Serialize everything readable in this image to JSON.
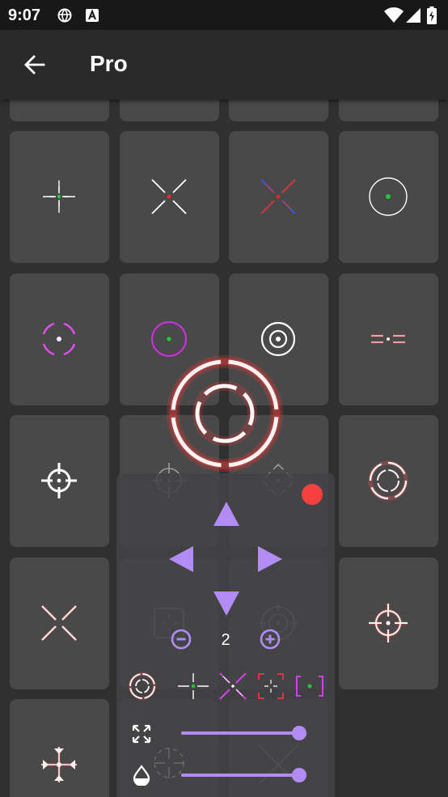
{
  "status_bar": {
    "time": "9:07",
    "icons": [
      "vpn-globe-icon",
      "text-a-icon",
      "wifi-icon",
      "signal-icon",
      "battery-icon"
    ]
  },
  "app_bar": {
    "title": "Pro",
    "back_icon": "arrow-back-icon"
  },
  "crosshair_grid": {
    "columns": 4,
    "tiles": [
      {
        "row": 0,
        "col": 0,
        "icon": "partial-tile"
      },
      {
        "row": 0,
        "col": 1,
        "icon": "partial-tile"
      },
      {
        "row": 0,
        "col": 2,
        "icon": "partial-tile"
      },
      {
        "row": 0,
        "col": 3,
        "icon": "partial-tile"
      },
      {
        "row": 1,
        "col": 0,
        "icon": "plus-green-dot-crosshair-icon"
      },
      {
        "row": 1,
        "col": 1,
        "icon": "x-red-dot-crosshair-icon"
      },
      {
        "row": 1,
        "col": 2,
        "icon": "x-red-blue-crosshair-icon"
      },
      {
        "row": 1,
        "col": 3,
        "icon": "circle-green-dot-crosshair-icon"
      },
      {
        "row": 2,
        "col": 0,
        "icon": "bracket-circle-magenta-icon"
      },
      {
        "row": 2,
        "col": 1,
        "icon": "circle-magenta-green-dot-icon"
      },
      {
        "row": 2,
        "col": 2,
        "icon": "double-circle-icon"
      },
      {
        "row": 2,
        "col": 3,
        "icon": "line-dot-line-red-icon"
      },
      {
        "row": 3,
        "col": 0,
        "icon": "circle-plus-crosshair-icon"
      },
      {
        "row": 3,
        "col": 1,
        "icon": "circle-plus-crosshair-dim-icon"
      },
      {
        "row": 3,
        "col": 2,
        "icon": "diamond-crosshair-icon"
      },
      {
        "row": 3,
        "col": 3,
        "icon": "dashed-double-ring-red-icon"
      },
      {
        "row": 4,
        "col": 0,
        "icon": "x-red-glow-icon"
      },
      {
        "row": 4,
        "col": 1,
        "icon": "square-dotted-icon"
      },
      {
        "row": 4,
        "col": 2,
        "icon": "target-rings-icon"
      },
      {
        "row": 4,
        "col": 3,
        "icon": "circle-cross-red-icon"
      },
      {
        "row": 5,
        "col": 0,
        "icon": "arrow-cross-icon"
      },
      {
        "row": 5,
        "col": 1,
        "icon": "empty"
      },
      {
        "row": 5,
        "col": 2,
        "icon": "x-thin-icon"
      }
    ]
  },
  "preview": {
    "icon": "segmented-double-ring-red-glow-icon",
    "glow_color": "#e23b3b"
  },
  "control_panel": {
    "record_button_color": "#f4403f",
    "arrows": [
      "arrow-up-icon",
      "arrow-left-icon",
      "arrow-right-icon",
      "arrow-down-icon"
    ],
    "arrow_color": "#b28cf5",
    "size_value": "2",
    "zoom_out_icon": "minus-circle-icon",
    "zoom_in_icon": "plus-circle-icon",
    "recent_crosshairs": [
      "segmented-ring-red-icon",
      "plus-green-dot-icon",
      "x-magenta-icon",
      "bracket-red-icon",
      "bracket-magenta-green-icon"
    ],
    "scale_slider": {
      "icon": "expand-icon",
      "value": 0.95
    },
    "opacity_slider": {
      "icon": "opacity-drop-icon",
      "value": 0.95
    }
  }
}
